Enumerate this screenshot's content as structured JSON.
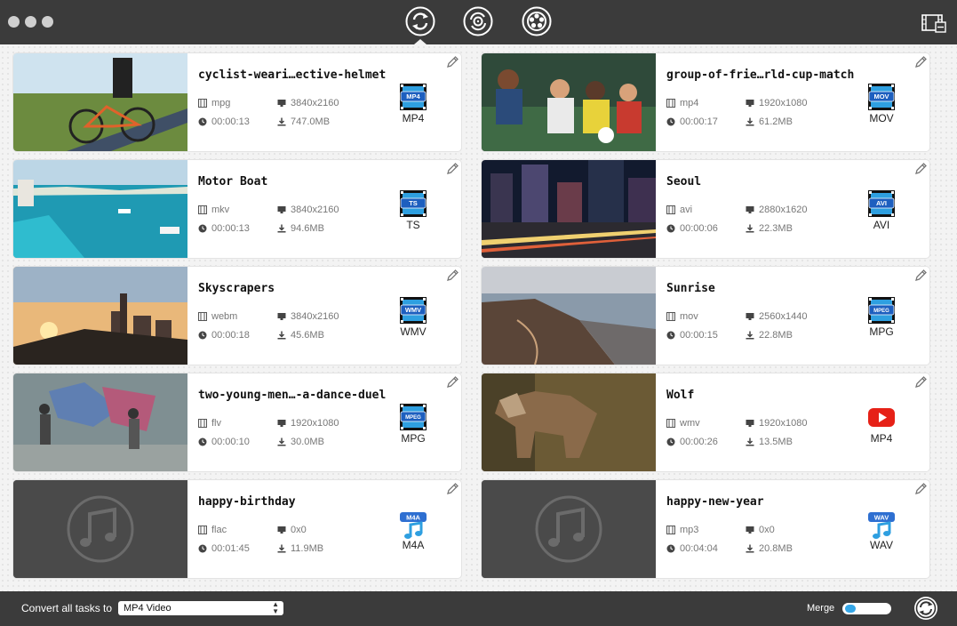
{
  "toolbar": {
    "tools": [
      {
        "name": "convert",
        "active": true
      },
      {
        "name": "dvd-convert",
        "active": false
      },
      {
        "name": "video-downloader",
        "active": false
      }
    ]
  },
  "colors": {
    "titlebar": "#3b3b3b",
    "accent": "#35a7e8",
    "format_blue": "#2e6fd1"
  },
  "tasks": [
    {
      "title": "cyclist-weari…ective-helmet",
      "container": "mpg",
      "resolution": "3840x2160",
      "duration": "00:00:13",
      "size": "747.0MB",
      "format_badge": "MP4",
      "format_label": "MP4",
      "thumb": "video"
    },
    {
      "title": "group-of-frie…rld-cup-match",
      "container": "mp4",
      "resolution": "1920x1080",
      "duration": "00:00:17",
      "size": "61.2MB",
      "format_badge": "MOV",
      "format_label": "MOV",
      "thumb": "video"
    },
    {
      "title": "Motor Boat",
      "container": "mkv",
      "resolution": "3840x2160",
      "duration": "00:00:13",
      "size": "94.6MB",
      "format_badge": "TS",
      "format_label": "TS",
      "thumb": "video"
    },
    {
      "title": "Seoul",
      "container": "avi",
      "resolution": "2880x1620",
      "duration": "00:00:06",
      "size": "22.3MB",
      "format_badge": "AVI",
      "format_label": "AVI",
      "thumb": "video"
    },
    {
      "title": "Skyscrapers",
      "container": "webm",
      "resolution": "3840x2160",
      "duration": "00:00:18",
      "size": "45.6MB",
      "format_badge": "WMV",
      "format_label": "WMV",
      "thumb": "video"
    },
    {
      "title": "Sunrise",
      "container": "mov",
      "resolution": "2560x1440",
      "duration": "00:00:15",
      "size": "22.8MB",
      "format_badge": "MPEG",
      "format_label": "MPG",
      "thumb": "video"
    },
    {
      "title": "two-young-men…-a-dance-duel",
      "container": "flv",
      "resolution": "1920x1080",
      "duration": "00:00:10",
      "size": "30.0MB",
      "format_badge": "MPEG",
      "format_label": "MPG",
      "thumb": "video"
    },
    {
      "title": "Wolf",
      "container": "wmv",
      "resolution": "1920x1080",
      "duration": "00:00:26",
      "size": "13.5MB",
      "format_badge": "",
      "format_label": "MP4",
      "thumb": "video"
    },
    {
      "title": "happy-birthday",
      "container": "flac",
      "resolution": "0x0",
      "duration": "00:01:45",
      "size": "11.9MB",
      "format_badge": "M4A",
      "format_label": "M4A",
      "thumb": "audio"
    },
    {
      "title": "happy-new-year",
      "container": "mp3",
      "resolution": "0x0",
      "duration": "00:04:04",
      "size": "20.8MB",
      "format_badge": "WAV",
      "format_label": "WAV",
      "thumb": "audio"
    }
  ],
  "bottom": {
    "convert_label": "Convert all tasks to",
    "selected_format": "MP4 Video",
    "merge_label": "Merge",
    "merge_on": false
  }
}
